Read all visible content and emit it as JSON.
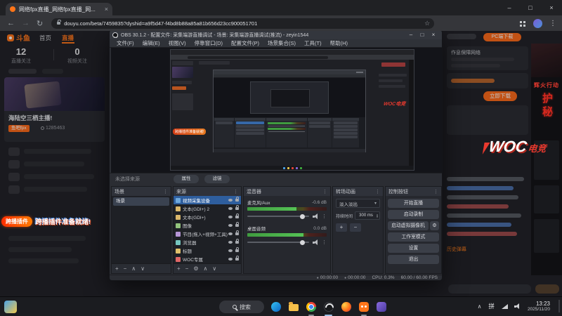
{
  "icons": {
    "back": "←",
    "forward": "→",
    "reload": "↻",
    "star": "☆",
    "kebab": "⋮",
    "min": "–",
    "max": "□",
    "close": "×",
    "plus": "+",
    "minus": "−",
    "gear": "⚙",
    "up": "∧",
    "down": "∨",
    "dots": "⋮",
    "dropdown": "▾",
    "spin_up": "▴",
    "spin_down": "▾",
    "bullet": "●",
    "chevron_up": "∧"
  },
  "browser": {
    "tab_title": "网络fpx直播_网络fpx直播_网...",
    "url": "douyu.com/beta/7459835?dyshid=a9f5d47-f4bd8b88a85a81b656d23cc900051701"
  },
  "douyu": {
    "logo": "斗鱼",
    "nav": [
      {
        "label": "首页"
      },
      {
        "label": "直播"
      }
    ],
    "stats": [
      {
        "value": "12",
        "label": "直播关注"
      },
      {
        "value": "0",
        "label": "视频关注"
      }
    ],
    "streamer": {
      "name": "海陆空三栖主播!",
      "badge": "鱼吧fpx",
      "followers": "1285463"
    },
    "toast": {
      "badge": "跨播插件",
      "text": "跨播插件准备就绪!"
    },
    "right": {
      "download_button": "PC端下载",
      "panel_title": "作息保障网络",
      "cta_button": "立即下载",
      "history_link": "历史弹幕",
      "banner_title": "辉火行动",
      "vertical_text": "护秘",
      "logo_en": "WOC",
      "logo_cn": "电竞"
    }
  },
  "obs": {
    "title": "OBS 30.1.2 - 配置文件: 采集端游直播调试 - 场景: 采集端游直播调试(推流) - zeyin1544",
    "menus": [
      "文件(F)",
      "编辑(E)",
      "视图(V)",
      "停靠窗口(D)",
      "配置文件(P)",
      "场景集合(S)",
      "工具(T)",
      "帮助(H)"
    ],
    "preview": {
      "toast": "跨播插件准备就绪!",
      "logo": "WOC电竞"
    },
    "context": {
      "label": "未选择来源",
      "properties": "属性",
      "filters": "滤镜"
    },
    "docks": {
      "scenes": {
        "title": "场景",
        "items": [
          "场景"
        ]
      },
      "sources": {
        "title": "来源",
        "items": [
          "视频采集设备",
          "文本(GDI+) 2",
          "文本(GDI+)",
          "图像",
          "节目(拖入+视频+工具)",
          "浏览器",
          "标题",
          "WOC专属"
        ]
      },
      "mixer": {
        "title": "混音器",
        "channels": [
          {
            "name": "麦克风/Aux",
            "db": "-0.6 dB"
          },
          {
            "name": "桌面音频",
            "db": "0.0 dB"
          }
        ]
      },
      "transitions": {
        "title": "转场动画",
        "selected": "淡入淡出",
        "duration_label": "持续时间",
        "duration": "300 ms"
      },
      "controls": {
        "title": "控制按钮",
        "buttons": [
          "开始直播",
          "启动录制",
          "启动虚拟摄像机",
          "工作室模式",
          "设置",
          "退出"
        ]
      }
    },
    "status": {
      "rec_time": "00:00:00",
      "stream_time": "00:00:00",
      "cpu": "CPU: 0.3%",
      "fps": "60.00 / 60.00 FPS"
    }
  },
  "taskbar": {
    "search": "搜索",
    "ime": "拼",
    "time": "13:23",
    "date": "2025/11/20"
  }
}
